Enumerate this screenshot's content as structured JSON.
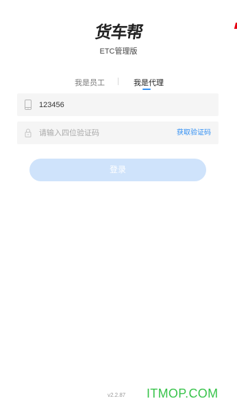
{
  "logo": {
    "text": "货车帮"
  },
  "subtitle": "ETC管理版",
  "tabs": [
    {
      "label": "我是员工",
      "active": false
    },
    {
      "label": "我是代理",
      "active": true
    }
  ],
  "colors": {
    "accent": "#2f8ef4",
    "field_bg": "#f5f5f5",
    "button_disabled": "#cfe3fb",
    "watermark": "#37c34a",
    "flag": "#e60012"
  },
  "phone_field": {
    "icon": "phone-icon",
    "value": "123456",
    "placeholder": ""
  },
  "code_field": {
    "icon": "lock-icon",
    "value": "",
    "placeholder": "请输入四位验证码",
    "action_label": "获取验证码"
  },
  "login_button": {
    "label": "登录",
    "enabled": false
  },
  "version": "v2.2.87",
  "watermark": "ITMOP.COM"
}
